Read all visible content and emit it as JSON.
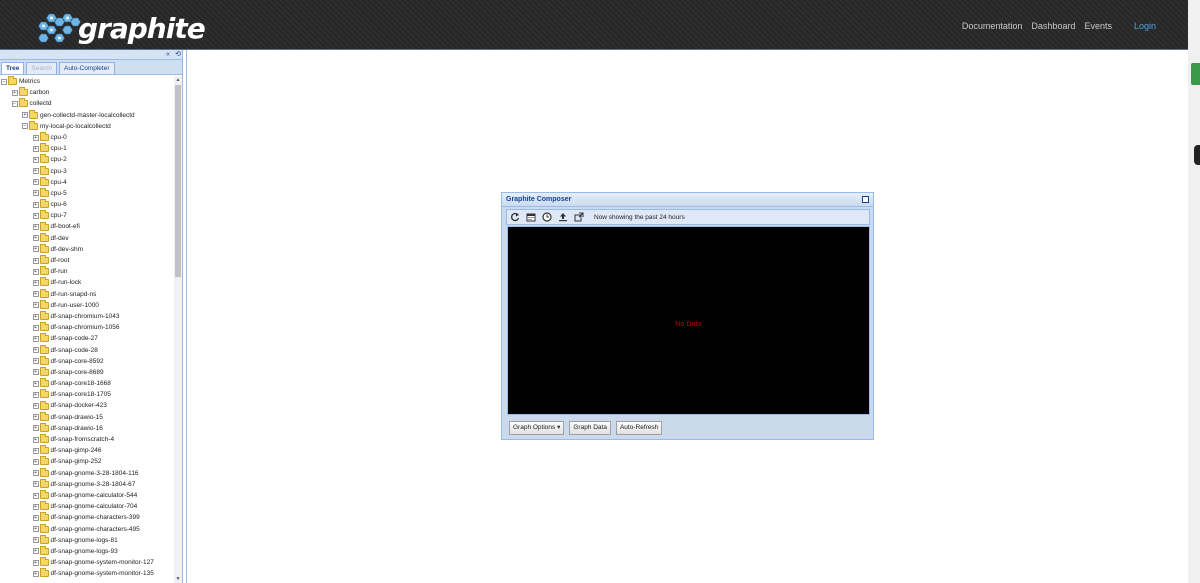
{
  "header": {
    "logo_text": "graphite",
    "nav": {
      "documentation": "Documentation",
      "dashboard": "Dashboard",
      "events": "Events",
      "login": "Login"
    }
  },
  "sidebar": {
    "tabs": [
      {
        "label": "Tree"
      },
      {
        "label": "Search"
      },
      {
        "label": "Auto-Completer"
      }
    ],
    "tree": [
      {
        "label": "Metrics",
        "depth": 0,
        "expanded": true
      },
      {
        "label": "carbon",
        "depth": 1,
        "expanded": false
      },
      {
        "label": "collectd",
        "depth": 1,
        "expanded": true
      },
      {
        "label": "gen-collectd-master-localcollectd",
        "depth": 2,
        "expanded": false
      },
      {
        "label": "my-local-pc-localcollectd",
        "depth": 2,
        "expanded": true
      },
      {
        "label": "cpu-0",
        "depth": 3,
        "expanded": false
      },
      {
        "label": "cpu-1",
        "depth": 3,
        "expanded": false
      },
      {
        "label": "cpu-2",
        "depth": 3,
        "expanded": false
      },
      {
        "label": "cpu-3",
        "depth": 3,
        "expanded": false
      },
      {
        "label": "cpu-4",
        "depth": 3,
        "expanded": false
      },
      {
        "label": "cpu-5",
        "depth": 3,
        "expanded": false
      },
      {
        "label": "cpu-6",
        "depth": 3,
        "expanded": false
      },
      {
        "label": "cpu-7",
        "depth": 3,
        "expanded": false
      },
      {
        "label": "df-boot-efi",
        "depth": 3,
        "expanded": false
      },
      {
        "label": "df-dev",
        "depth": 3,
        "expanded": false
      },
      {
        "label": "df-dev-shm",
        "depth": 3,
        "expanded": false
      },
      {
        "label": "df-root",
        "depth": 3,
        "expanded": false
      },
      {
        "label": "df-run",
        "depth": 3,
        "expanded": false
      },
      {
        "label": "df-run-lock",
        "depth": 3,
        "expanded": false
      },
      {
        "label": "df-run-snapd-ns",
        "depth": 3,
        "expanded": false
      },
      {
        "label": "df-run-user-1000",
        "depth": 3,
        "expanded": false
      },
      {
        "label": "df-snap-chromium-1043",
        "depth": 3,
        "expanded": false
      },
      {
        "label": "df-snap-chromium-1056",
        "depth": 3,
        "expanded": false
      },
      {
        "label": "df-snap-code-27",
        "depth": 3,
        "expanded": false
      },
      {
        "label": "df-snap-code-28",
        "depth": 3,
        "expanded": false
      },
      {
        "label": "df-snap-core-8592",
        "depth": 3,
        "expanded": false
      },
      {
        "label": "df-snap-core-8689",
        "depth": 3,
        "expanded": false
      },
      {
        "label": "df-snap-core18-1668",
        "depth": 3,
        "expanded": false
      },
      {
        "label": "df-snap-core18-1705",
        "depth": 3,
        "expanded": false
      },
      {
        "label": "df-snap-docker-423",
        "depth": 3,
        "expanded": false
      },
      {
        "label": "df-snap-drawio-15",
        "depth": 3,
        "expanded": false
      },
      {
        "label": "df-snap-drawio-16",
        "depth": 3,
        "expanded": false
      },
      {
        "label": "df-snap-fromscratch-4",
        "depth": 3,
        "expanded": false
      },
      {
        "label": "df-snap-gimp-246",
        "depth": 3,
        "expanded": false
      },
      {
        "label": "df-snap-gimp-252",
        "depth": 3,
        "expanded": false
      },
      {
        "label": "df-snap-gnome-3-28-1804-116",
        "depth": 3,
        "expanded": false
      },
      {
        "label": "df-snap-gnome-3-28-1804-67",
        "depth": 3,
        "expanded": false
      },
      {
        "label": "df-snap-gnome-calculator-544",
        "depth": 3,
        "expanded": false
      },
      {
        "label": "df-snap-gnome-calculator-704",
        "depth": 3,
        "expanded": false
      },
      {
        "label": "df-snap-gnome-characters-399",
        "depth": 3,
        "expanded": false
      },
      {
        "label": "df-snap-gnome-characters-495",
        "depth": 3,
        "expanded": false
      },
      {
        "label": "df-snap-gnome-logs-81",
        "depth": 3,
        "expanded": false
      },
      {
        "label": "df-snap-gnome-logs-93",
        "depth": 3,
        "expanded": false
      },
      {
        "label": "df-snap-gnome-system-monitor-127",
        "depth": 3,
        "expanded": false
      },
      {
        "label": "df-snap-gnome-system-monitor-135",
        "depth": 3,
        "expanded": false
      }
    ]
  },
  "composer": {
    "title": "Graphite Composer",
    "toolbar": {
      "icons": [
        "refresh-icon",
        "calendar-icon",
        "clock-icon",
        "upload-icon",
        "share-icon"
      ],
      "status": "Now showing the past 24 hours"
    },
    "graph": {
      "message": "No Data"
    },
    "buttons": {
      "graph_options": "Graph Options",
      "graph_data": "Graph Data",
      "auto_refresh": "Auto-Refresh"
    }
  }
}
